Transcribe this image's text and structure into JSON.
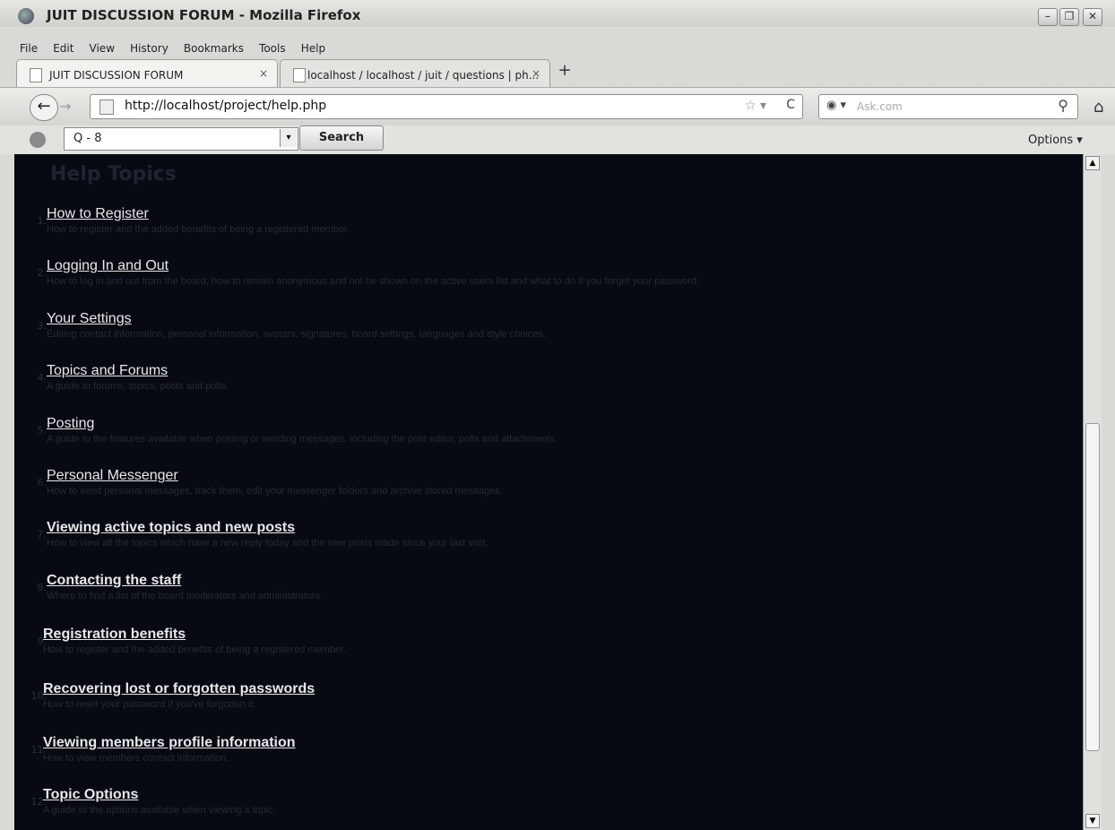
{
  "window": {
    "title": "JUIT DISCUSSION FORUM - Mozilla Firefox",
    "minimize_glyph": "–",
    "restore_glyph": "❐",
    "close_glyph": "✕"
  },
  "menubar": [
    "File",
    "Edit",
    "View",
    "History",
    "Bookmarks",
    "Tools",
    "Help"
  ],
  "tabs": [
    {
      "label": "JUIT DISCUSSION FORUM",
      "close": "×",
      "active": true
    },
    {
      "label": "localhost / localhost / juit / questions | ph...",
      "close": "×",
      "active": false
    }
  ],
  "new_tab": "+",
  "nav": {
    "back": "←",
    "forward": "→",
    "url": "http://localhost/project/help.php",
    "star": "☆ ▾",
    "reload": "C",
    "search_placeholder": "Ask.com",
    "search_engine_icon": "◉ ▾",
    "magnifier": "⚲",
    "home": "⌂"
  },
  "toolbar2": {
    "combo_value": "Q - 8",
    "combo_arrow": "▾",
    "search_button": "Search",
    "options": "Options ▾"
  },
  "content": {
    "heading": "Help Topics",
    "topics": [
      {
        "num": "1.",
        "title": "How to Register",
        "desc": "How to register and the added benefits of being a registered member."
      },
      {
        "num": "2.",
        "title": "Logging In and Out",
        "desc": "How to log in and out from the board, how to remain anonymous and not be shown on the active users list and what to do if you forget your password."
      },
      {
        "num": "3.",
        "title": "Your Settings",
        "desc": "Editing contact information, personal information, avatars, signatures, board settings, languages and style choices."
      },
      {
        "num": "4.",
        "title": "Topics and Forums",
        "desc": "A guide to forums, topics, posts and polls."
      },
      {
        "num": "5.",
        "title": "Posting",
        "desc": "A guide to the features available when posting or sending messages, including the post editor, polls and attachments."
      },
      {
        "num": "6.",
        "title": "Personal Messenger",
        "desc": "How to send personal messages, track them, edit your messenger folders and archive stored messages."
      },
      {
        "num": "7.",
        "title": "Viewing active topics and new posts",
        "desc": "How to view all the topics which have a new reply today and the new posts made since your last visit."
      },
      {
        "num": "8.",
        "title": "Contacting the staff",
        "desc": "Where to find a list of the board moderators and administrators."
      },
      {
        "num": "9.",
        "title": "Registration benefits",
        "desc": "How to register and the added benefits of being a registered member."
      },
      {
        "num": "10.",
        "title": "Recovering lost or forgotten passwords",
        "desc": "How to reset your password if you've forgotten it."
      },
      {
        "num": "11.",
        "title": "Viewing members profile information",
        "desc": "How to view members contact information."
      },
      {
        "num": "12.",
        "title": "Topic Options",
        "desc": "A guide to the options available when viewing a topic."
      }
    ]
  },
  "scrollbar": {
    "up": "▲",
    "down": "▼"
  }
}
